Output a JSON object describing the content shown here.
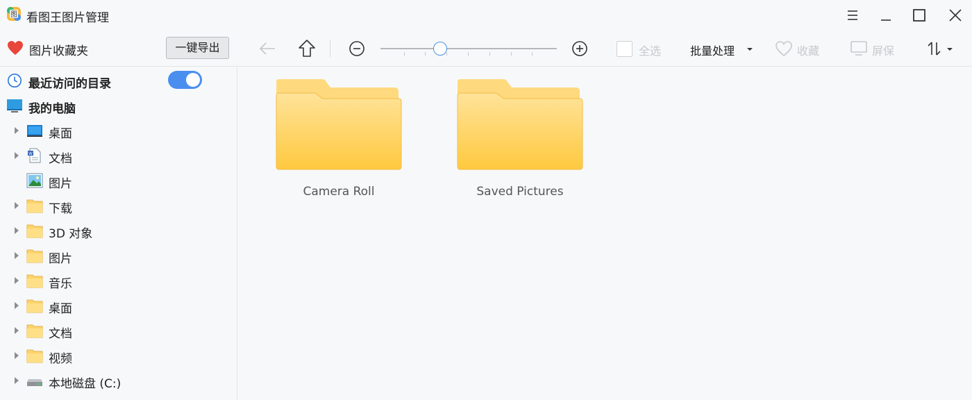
{
  "window": {
    "title": "看图王图片管理"
  },
  "toolbar": {
    "favorites_label": "图片收藏夹",
    "export_label": "一键导出",
    "select_all_label": "全选",
    "batch_label": "批量处理",
    "collect_label": "收藏",
    "screensaver_label": "屏保",
    "zoom_level": 0.34
  },
  "sidebar": {
    "recent_label": "最近访问的目录",
    "recent_toggle_on": true,
    "computer_label": "我的电脑",
    "items": [
      {
        "label": "桌面",
        "icon": "desktop-icon",
        "expandable": true
      },
      {
        "label": "文档",
        "icon": "document-icon",
        "expandable": true
      },
      {
        "label": "图片",
        "icon": "picture-icon",
        "expandable": false
      },
      {
        "label": "下载",
        "icon": "folder-icon",
        "expandable": true
      },
      {
        "label": "3D 对象",
        "icon": "folder-icon",
        "expandable": true
      },
      {
        "label": "图片",
        "icon": "folder-icon",
        "expandable": true
      },
      {
        "label": "音乐",
        "icon": "folder-icon",
        "expandable": true
      },
      {
        "label": "桌面",
        "icon": "folder-icon",
        "expandable": true
      },
      {
        "label": "文档",
        "icon": "folder-icon",
        "expandable": true
      },
      {
        "label": "视频",
        "icon": "folder-icon",
        "expandable": true
      },
      {
        "label": "本地磁盘 (C:)",
        "icon": "drive-icon",
        "expandable": true
      }
    ]
  },
  "main": {
    "folders": [
      {
        "name": "Camera Roll"
      },
      {
        "name": "Saved Pictures"
      }
    ]
  },
  "colors": {
    "accent": "#4a8ef0",
    "heart": "#e8453c",
    "folder": "#ffd46b"
  }
}
